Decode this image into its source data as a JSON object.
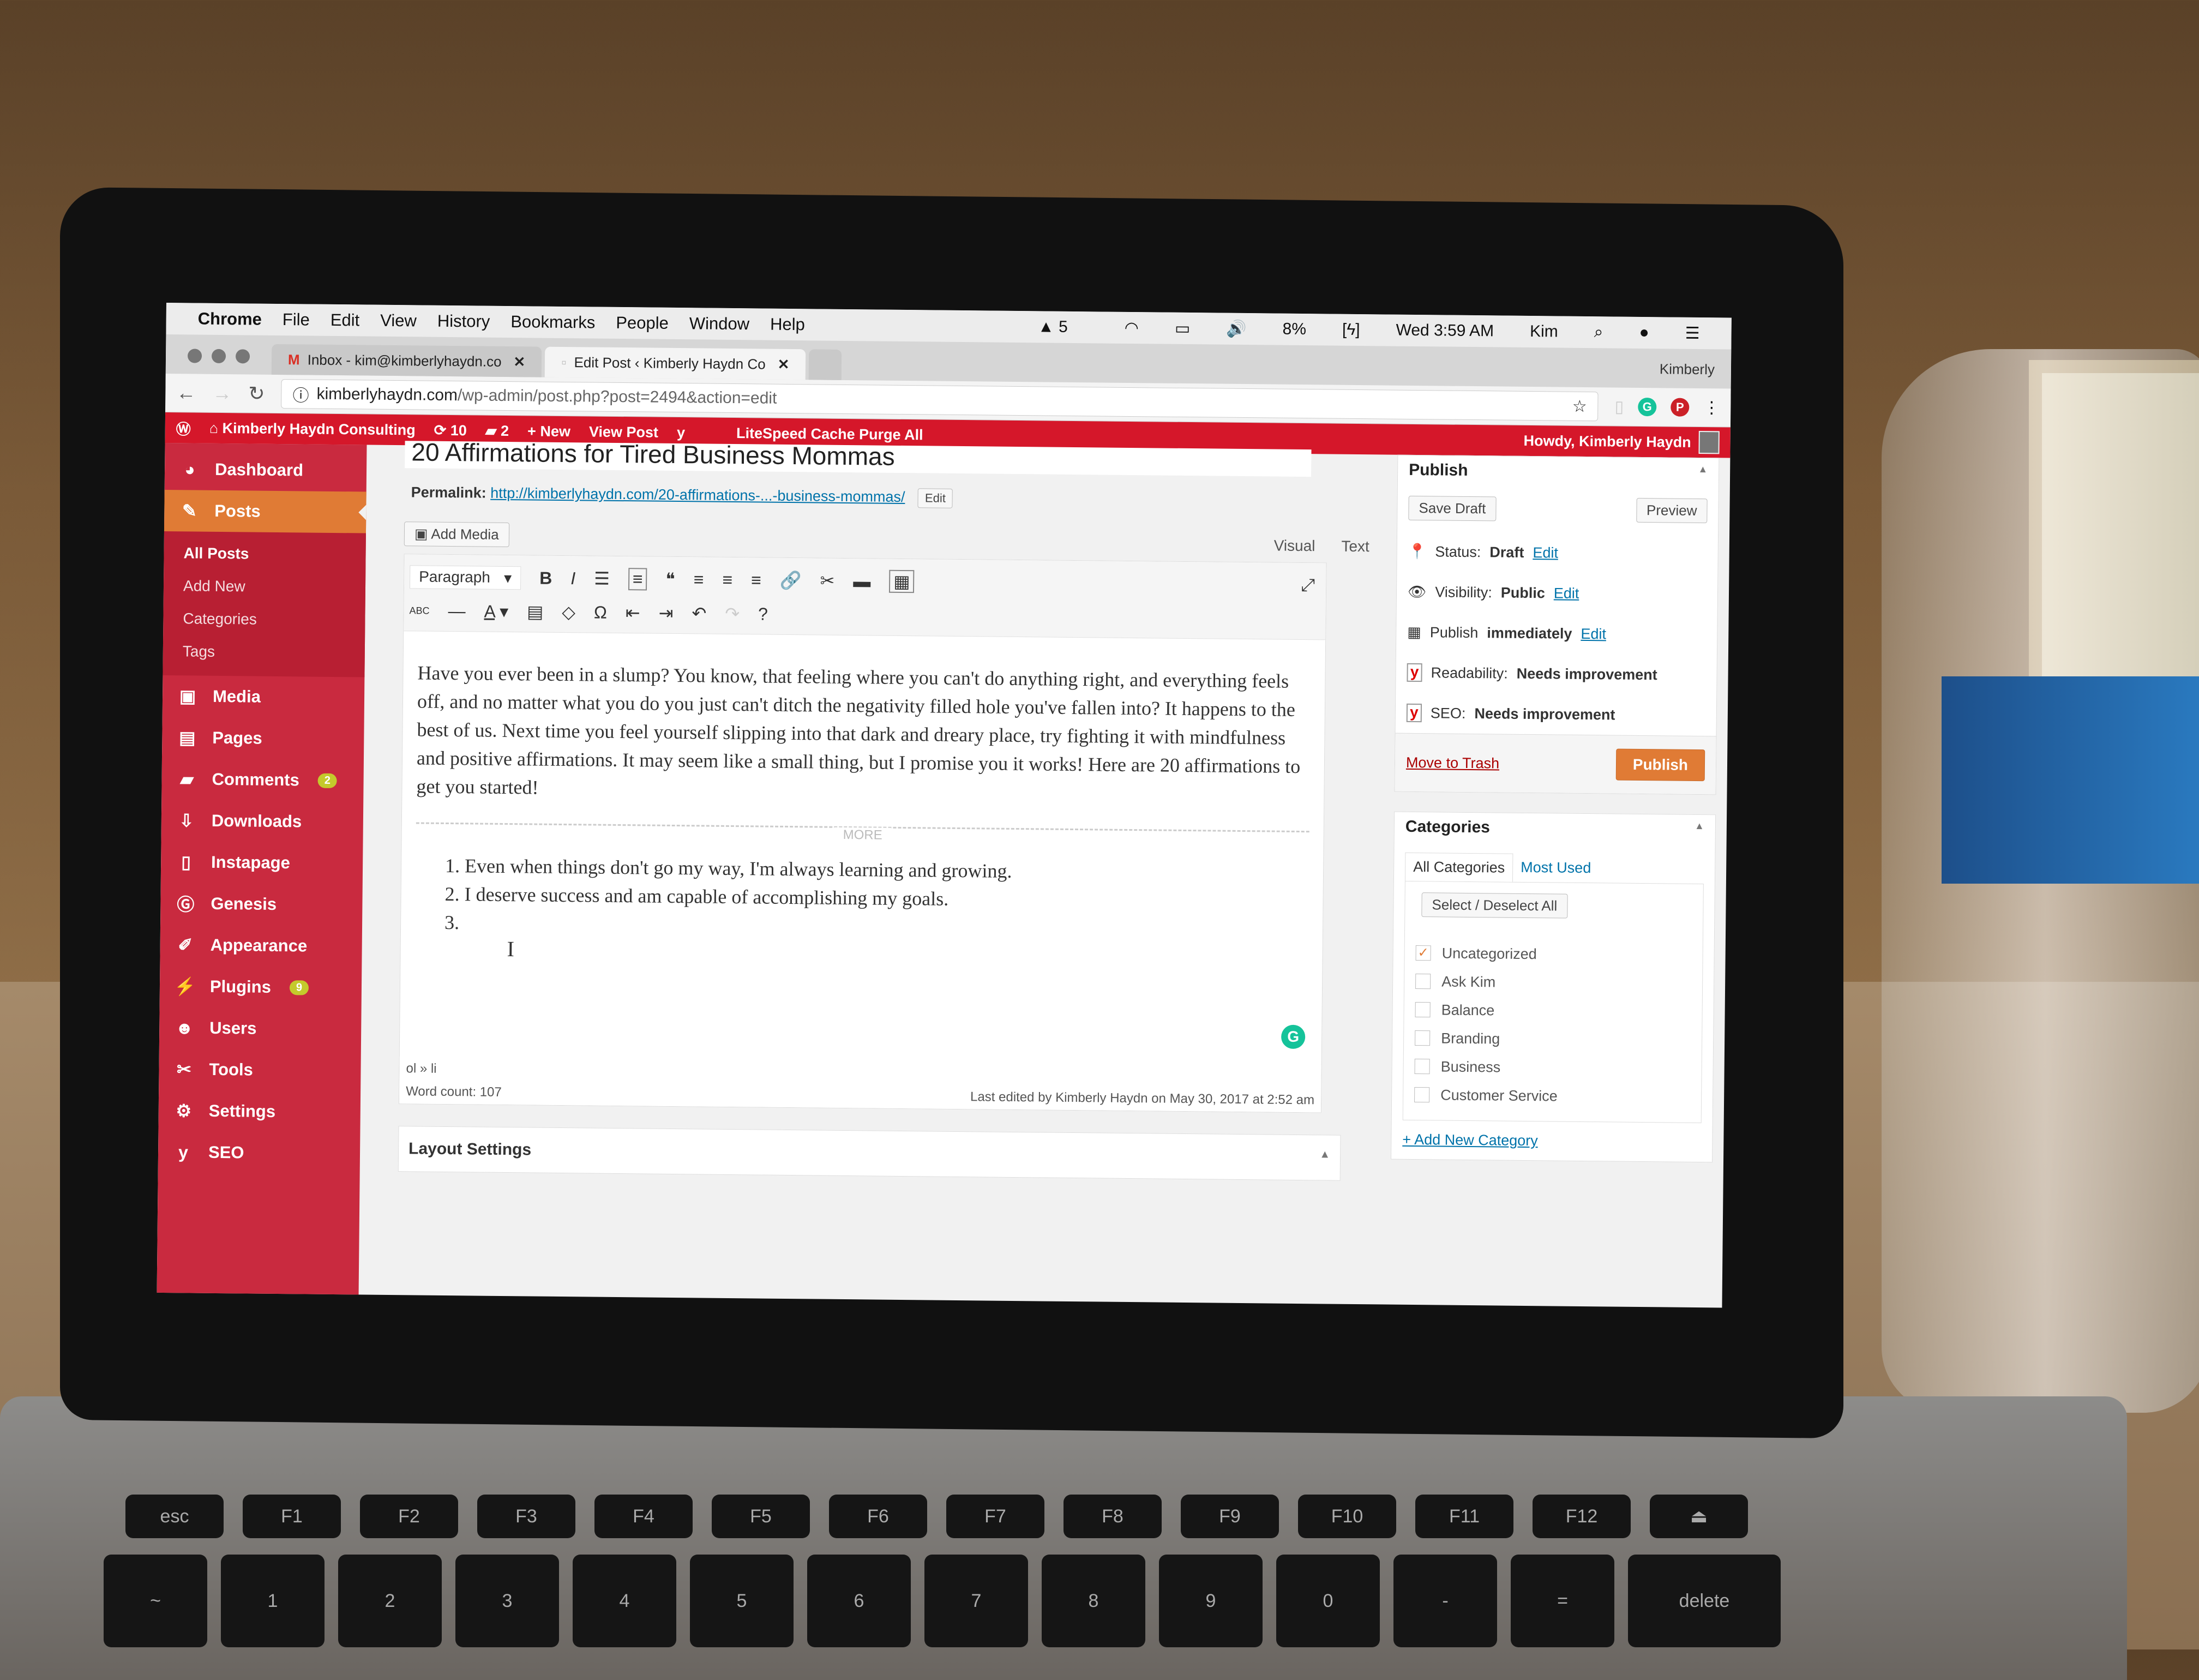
{
  "mac_menu": {
    "app": "Chrome",
    "items": [
      "File",
      "Edit",
      "View",
      "History",
      "Bookmarks",
      "People",
      "Window",
      "Help"
    ],
    "status": {
      "adobe_count": "5",
      "battery": "8%",
      "clock": "Wed 3:59 AM",
      "user": "Kim"
    }
  },
  "browser": {
    "tabs": [
      {
        "title": "Inbox - kim@kimberlyhaydn.co",
        "icon": "gmail-icon",
        "active": false
      },
      {
        "title": "Edit Post ‹ Kimberly Haydn Co",
        "icon": "page-icon",
        "active": true
      }
    ],
    "profile": "Kimberly",
    "url_host": "kimberlyhaydn.com",
    "url_path": "/wp-admin/post.php?post=2494&action=edit"
  },
  "adminbar": {
    "site": "Kimberly Haydn Consulting",
    "updates": "10",
    "comments": "2",
    "new": "New",
    "view_post": "View Post",
    "litespeed": "LiteSpeed Cache Purge All",
    "howdy": "Howdy, Kimberly Haydn"
  },
  "sidebar": {
    "items": [
      {
        "label": "Dashboard",
        "icon": "dashboard-icon",
        "glyph": "◕"
      },
      {
        "label": "Posts",
        "icon": "pin-icon",
        "glyph": "✎",
        "current": true
      },
      {
        "label": "Media",
        "icon": "media-icon",
        "glyph": "▣"
      },
      {
        "label": "Pages",
        "icon": "pages-icon",
        "glyph": "▤"
      },
      {
        "label": "Comments",
        "icon": "comment-icon",
        "glyph": "▰",
        "badge": "2"
      },
      {
        "label": "Downloads",
        "icon": "download-icon",
        "glyph": "⇩"
      },
      {
        "label": "Instapage",
        "icon": "instapage-icon",
        "glyph": "▯"
      },
      {
        "label": "Genesis",
        "icon": "genesis-icon",
        "glyph": "Ⓖ"
      },
      {
        "label": "Appearance",
        "icon": "brush-icon",
        "glyph": "✐"
      },
      {
        "label": "Plugins",
        "icon": "plugin-icon",
        "glyph": "⚡",
        "badge": "9"
      },
      {
        "label": "Users",
        "icon": "user-icon",
        "glyph": "☻"
      },
      {
        "label": "Tools",
        "icon": "wrench-icon",
        "glyph": "✂"
      },
      {
        "label": "Settings",
        "icon": "settings-icon",
        "glyph": "⚙"
      },
      {
        "label": "SEO",
        "icon": "yoast-icon",
        "glyph": "y"
      }
    ],
    "posts_submenu": [
      "All Posts",
      "Add New",
      "Categories",
      "Tags"
    ]
  },
  "post": {
    "title": "20 Affirmations for Tired Business Mommas",
    "permalink_label": "Permalink:",
    "permalink_url": "http://kimberlyhaydn.com/20-affirmations-...-business-mommas/",
    "permalink_edit": "Edit",
    "add_media": "Add Media",
    "mode_visual": "Visual",
    "mode_text": "Text",
    "format": "Paragraph",
    "intro": "Have you ever been in a slump? You know, that feeling where you can't do anything right, and everything feels off, and no matter what you do you just can't ditch the negativity filled hole you've fallen into? It happens to the best of us. Next time you feel yourself slipping into that dark and dreary place, try fighting it with mindfulness and positive affirmations. It may seem like a small thing, but I promise you it works! Here are 20 affirmations to get you started!",
    "more_label": "MORE",
    "list": [
      "Even when things don't go my way, I'm always learning and growing.",
      "I deserve success and am capable of accomplishing my goals.",
      ""
    ],
    "path": "ol » li",
    "word_count": "Word count: 107",
    "last_edited": "Last edited by Kimberly Haydn on May 30, 2017 at 2:52 am",
    "layout_settings": "Layout Settings"
  },
  "publish": {
    "title": "Publish",
    "save_draft": "Save Draft",
    "preview": "Preview",
    "status_label": "Status:",
    "status_value": "Draft",
    "visibility_label": "Visibility:",
    "visibility_value": "Public",
    "schedule_label": "Publish",
    "schedule_value": "immediately",
    "readability_label": "Readability:",
    "readability_value": "Needs improvement",
    "seo_label": "SEO:",
    "seo_value": "Needs improvement",
    "edit": "Edit",
    "trash": "Move to Trash",
    "publish": "Publish"
  },
  "categories": {
    "title": "Categories",
    "tab_all": "All Categories",
    "tab_most": "Most Used",
    "select_all": "Select / Deselect All",
    "items": [
      {
        "label": "Uncategorized",
        "checked": true
      },
      {
        "label": "Ask Kim",
        "checked": false
      },
      {
        "label": "Balance",
        "checked": false
      },
      {
        "label": "Branding",
        "checked": false
      },
      {
        "label": "Business",
        "checked": false
      },
      {
        "label": "Customer Service",
        "checked": false
      }
    ],
    "add_new": "+ Add New Category"
  },
  "keyboard": {
    "fn_row": [
      "esc",
      "F1",
      "F2",
      "F3",
      "F4",
      "F5",
      "F6",
      "F7",
      "F8",
      "F9",
      "F10",
      "F11",
      "F12",
      "⏏"
    ],
    "num_row": [
      "~",
      "1",
      "2",
      "3",
      "4",
      "5",
      "6",
      "7",
      "8",
      "9",
      "0",
      "-",
      "=",
      "delete"
    ]
  },
  "colors": {
    "admin_red": "#d5172a",
    "sidebar_red": "#c92a3f",
    "accent_orange": "#e07b35",
    "link_blue": "#0073aa"
  }
}
